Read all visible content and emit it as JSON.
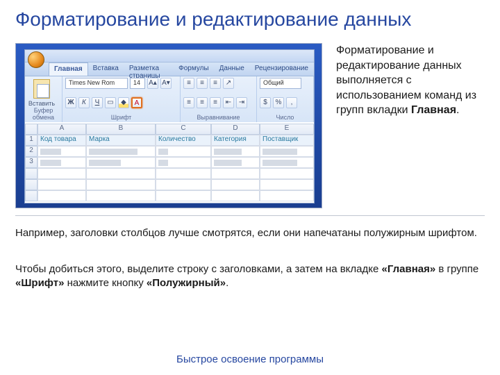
{
  "title": "Форматирование и редактирование данных",
  "side_text_plain": "Форматирование и редактирование данных выполняется с использованием команд из групп вкладки ",
  "side_text_bold": "Главная",
  "body1": "Например, заголовки столбцов лучше смотрятся, если они напечатаны полужирным шрифтом.",
  "body2_pre": "Чтобы добиться этого, выделите строку с заголовками, а затем на вкладке ",
  "body2_b1": "«Главная»",
  "body2_mid1": " в группе ",
  "body2_b2": "«Шрифт»",
  "body2_mid2": " нажмите кнопку ",
  "body2_b3": "«Полужирный»",
  "body2_end": ".",
  "footer": "Быстрое освоение программы",
  "ribbon": {
    "tabs": [
      "Главная",
      "Вставка",
      "Разметка страницы",
      "Формулы",
      "Данные",
      "Рецензирование"
    ],
    "paste_label": "Вставить",
    "group_clipboard": "Буфер обмена",
    "group_font": "Шрифт",
    "group_align": "Выравнивание",
    "group_number": "Число",
    "font_name": "Times New Rom",
    "font_size": "14",
    "bold": "Ж",
    "italic": "К",
    "underline": "Ч",
    "number_format": "Общий"
  },
  "sheet": {
    "cols": [
      "A",
      "B",
      "C",
      "D",
      "E"
    ],
    "row1": {
      "A": "Код товара",
      "B": "Марка",
      "C": "Количество",
      "D": "Категория",
      "E": "Поставщик"
    }
  }
}
